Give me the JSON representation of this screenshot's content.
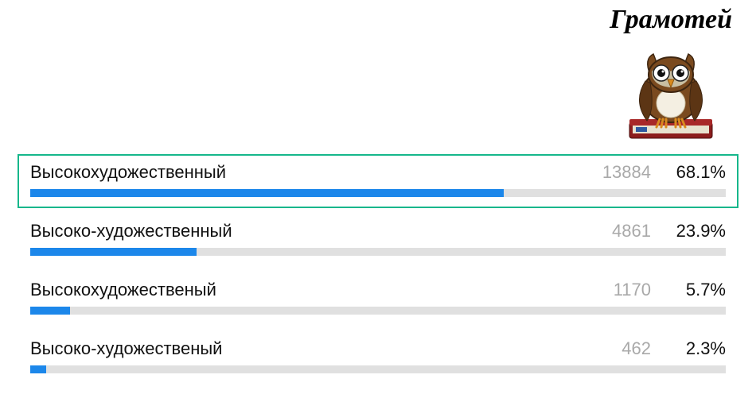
{
  "brand": {
    "name": "Грамотей"
  },
  "chart_data": {
    "type": "bar",
    "title": "",
    "xlabel": "",
    "ylabel": "",
    "categories": [
      "Высокохудожественный",
      "Высоко-художественный",
      "Высокохудожественый",
      "Высоко-художественый"
    ],
    "series": [
      {
        "name": "count",
        "values": [
          13884,
          4861,
          1170,
          462
        ]
      },
      {
        "name": "percent",
        "values": [
          68.1,
          23.9,
          5.7,
          2.3
        ]
      }
    ],
    "correct_index": 0
  },
  "options": [
    {
      "label": "Высокохудожественный",
      "count": "13884",
      "percent": "68.1%",
      "bar_pct": 68.1,
      "correct": true
    },
    {
      "label": "Высоко-художественный",
      "count": "4861",
      "percent": "23.9%",
      "bar_pct": 23.9,
      "correct": false
    },
    {
      "label": "Высокохудожественый",
      "count": "1170",
      "percent": "5.7%",
      "bar_pct": 5.7,
      "correct": false
    },
    {
      "label": "Высоко-художественый",
      "count": "462",
      "percent": "2.3%",
      "bar_pct": 2.3,
      "correct": false
    }
  ]
}
